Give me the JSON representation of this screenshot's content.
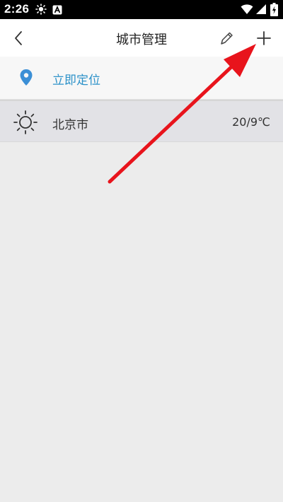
{
  "status_bar": {
    "time": "2:26",
    "icons": [
      "sun-icon",
      "a-notification-icon",
      "wifi-icon",
      "signal-icon",
      "battery-charging-icon"
    ]
  },
  "header": {
    "title": "城市管理",
    "back_icon": "chevron-left-icon",
    "edit_icon": "pencil-icon",
    "add_icon": "plus-icon"
  },
  "locate": {
    "label": "立即定位",
    "icon": "location-pin-icon",
    "color": "#2d92c9"
  },
  "cities": [
    {
      "name": "北京市",
      "temp": "20/9℃",
      "weather_icon": "sun-icon"
    }
  ],
  "annotation": {
    "type": "red-arrow",
    "target": "add-button",
    "color": "#e8141c"
  }
}
